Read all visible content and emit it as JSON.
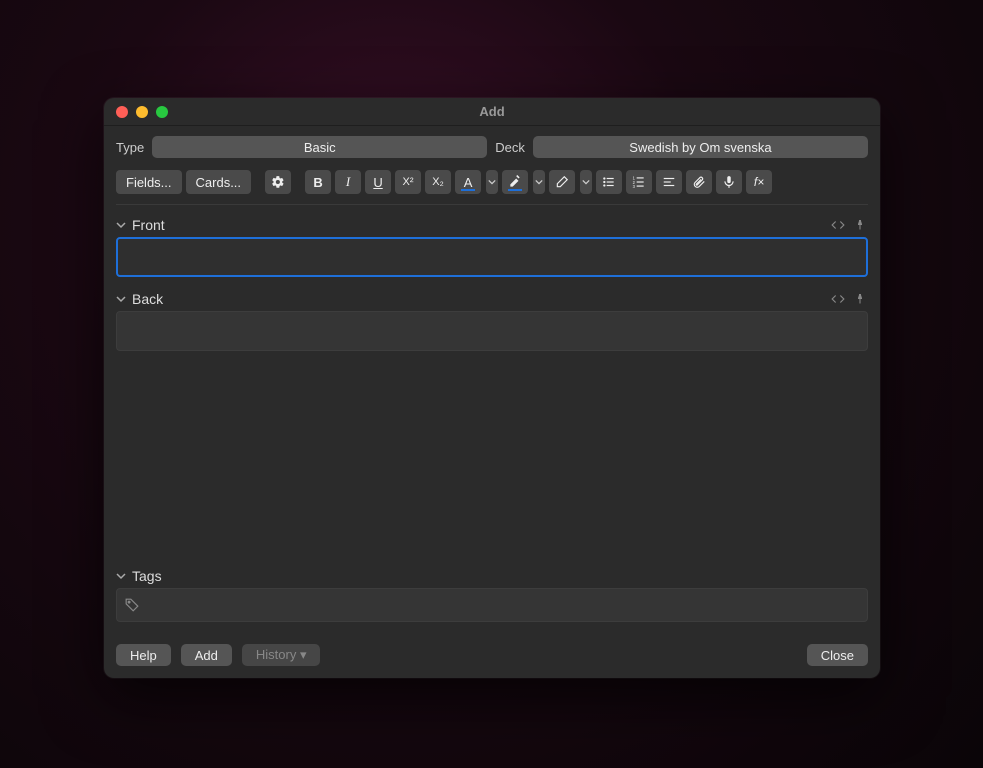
{
  "window": {
    "title": "Add"
  },
  "selectors": {
    "type_label": "Type",
    "type_value": "Basic",
    "deck_label": "Deck",
    "deck_value": "Swedish by Om svenska"
  },
  "toolbar": {
    "fields_label": "Fields...",
    "cards_label": "Cards...",
    "text_color": "#1e6fd9",
    "highlight_color": "#1e6fd9"
  },
  "fields": {
    "front_label": "Front",
    "front_value": "",
    "back_label": "Back",
    "back_value": ""
  },
  "tags": {
    "label": "Tags"
  },
  "footer": {
    "help_label": "Help",
    "add_label": "Add",
    "history_label": "History ▾",
    "close_label": "Close"
  }
}
